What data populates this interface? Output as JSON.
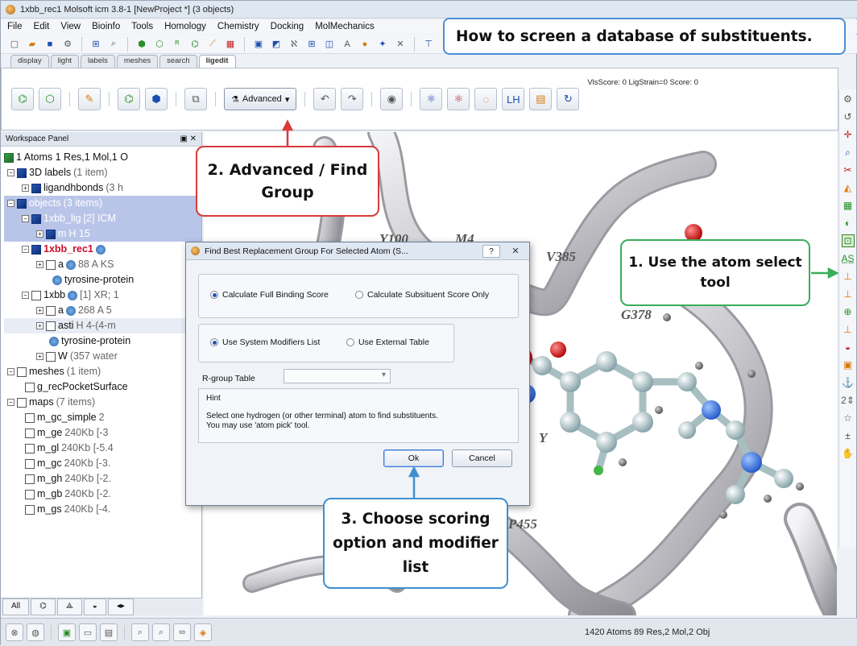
{
  "window": {
    "title": "1xbb_rec1 Molsoft icm 3.8-1  [NewProject *] (3 objects)"
  },
  "menu": [
    "File",
    "Edit",
    "View",
    "Bioinfo",
    "Tools",
    "Homology",
    "Chemistry",
    "Docking",
    "MolMechanics"
  ],
  "tabs": [
    "display",
    "light",
    "labels",
    "meshes",
    "search",
    "ligedit"
  ],
  "active_tab": "ligedit",
  "ligedit_toolbar": {
    "advanced_label": "Advanced",
    "score_text": "VlsScore: 0 LigStrain=0 Score: 0"
  },
  "workspace": {
    "title": "Workspace Panel",
    "header_root": "1 Atoms 1 Res,1 Mol,1 O",
    "items": [
      {
        "name": "3D labels",
        "meta": "(1 item)"
      },
      {
        "name": "ligandhbonds",
        "meta": "(3 h"
      },
      {
        "name": "objects",
        "meta": "(3 items)"
      },
      {
        "name": "1xbb_lig",
        "meta": "[2] ICM"
      },
      {
        "name": "m",
        "meta": "H  15"
      },
      {
        "name": "1xbb_rec1",
        "meta": ""
      },
      {
        "name": "a",
        "meta": "88 A  KS"
      },
      {
        "name": "tyrosine-protein",
        "meta": ""
      },
      {
        "name": "1xbb",
        "meta": "[1] XR; 1"
      },
      {
        "name": "a",
        "meta": "268 A  5"
      },
      {
        "name": "asti",
        "meta": "H  4-(4-m"
      },
      {
        "name": "tyrosine-protein",
        "meta": ""
      },
      {
        "name": "W",
        "meta": "(357 water"
      },
      {
        "name": "meshes",
        "meta": "(1 item)"
      },
      {
        "name": "g_recPocketSurface",
        "meta": ""
      },
      {
        "name": "maps",
        "meta": "(7 items)"
      },
      {
        "name": "m_gc_simple",
        "meta": "2"
      },
      {
        "name": "m_ge",
        "meta": "240Kb [-3"
      },
      {
        "name": "m_gl",
        "meta": "240Kb [-5.4"
      },
      {
        "name": "m_gc",
        "meta": "240Kb [-3."
      },
      {
        "name": "m_gh",
        "meta": "240Kb [-2."
      },
      {
        "name": "m_gb",
        "meta": "240Kb [-2."
      },
      {
        "name": "m_gs",
        "meta": "240Kb [-4."
      }
    ],
    "bottom_tab": "All"
  },
  "view3d": {
    "residue_labels": [
      "Y100",
      "M4",
      "V385",
      "G378",
      "P455",
      "Y"
    ]
  },
  "dialog": {
    "title": "Find Best Replacement Group For Selected Atom (S...",
    "help": "?",
    "close": "✕",
    "score_options": [
      "Calculate Full Binding Score",
      "Calculate Subsituent Score Only"
    ],
    "score_selected": "Calculate Full Binding Score",
    "modifier_options": [
      "Use System Modifiers List",
      "Use External Table"
    ],
    "modifier_selected": "Use System Modifiers List",
    "rgroup_label": "R-group Table",
    "rgroup_value": "",
    "hint_title": "Hint",
    "hint_text": "Select one hydrogen (or other terminal) atom to find substituents.\nYou may use 'atom pick' tool.",
    "ok": "Ok",
    "cancel": "Cancel"
  },
  "callouts": {
    "title": "How to screen a database of substituents.",
    "step1": "1. Use the atom select tool",
    "step2": "2. Advanced / Find Group",
    "step3": "3. Choose scoring option and modifier list"
  },
  "status": {
    "text": "1420 Atoms 89 Res,2 Mol,2 Obj"
  },
  "colors": {
    "callout1": "#38ae5a",
    "callout2": "#d93a3a",
    "callout3": "#3f8fd3",
    "title_border": "#4b8ed8",
    "highlight": "#b9c5e8",
    "rec_name": "#c8102e"
  }
}
